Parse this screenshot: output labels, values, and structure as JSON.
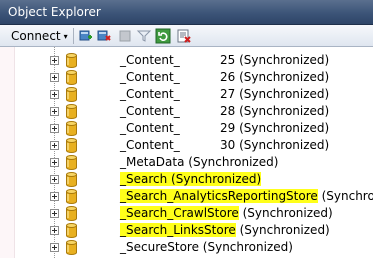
{
  "window": {
    "title": "Object Explorer"
  },
  "toolbar": {
    "connect_label": "Connect",
    "connect_arrow": "▾",
    "icons": [
      "connect-server-icon",
      "disconnect-server-icon",
      "stop-icon",
      "filter-icon",
      "refresh-icon",
      "summary-report-icon"
    ]
  },
  "tree": {
    "rows": [
      {
        "prefix": "_Content_",
        "suffix": "25 (Synchronized)",
        "highlight": false
      },
      {
        "prefix": "_Content_",
        "suffix": "26 (Synchronized)",
        "highlight": false
      },
      {
        "prefix": "_Content_",
        "suffix": "27 (Synchronized)",
        "highlight": false
      },
      {
        "prefix": "_Content_",
        "suffix": "28 (Synchronized)",
        "highlight": false
      },
      {
        "prefix": "_Content_",
        "suffix": "29 (Synchronized)",
        "highlight": false
      },
      {
        "prefix": "_Content_",
        "suffix": "30 (Synchronized)",
        "highlight": false
      },
      {
        "name": "_MetaData",
        "status": " (Synchronized)",
        "highlight": false
      },
      {
        "name": "_Search",
        "status": " (Synchronized)",
        "highlight": true,
        "highlight_status": true
      },
      {
        "name": "_Search_AnalyticsReportingStore",
        "status": " (Synchronized)",
        "highlight": true,
        "highlight_status": false
      },
      {
        "name": "_Search_CrawlStore",
        "status": " (Synchronized)",
        "highlight": true,
        "highlight_status": false
      },
      {
        "name": "_Search_LinksStore",
        "status": " (Synchronized)",
        "highlight": true,
        "highlight_status": false
      },
      {
        "name": "_SecureStore",
        "status": " (Synchronized)",
        "highlight": false
      }
    ]
  },
  "colors": {
    "highlight": "#ffff1a",
    "titlebar": "#3c5478",
    "db_icon": "#e8b020"
  }
}
